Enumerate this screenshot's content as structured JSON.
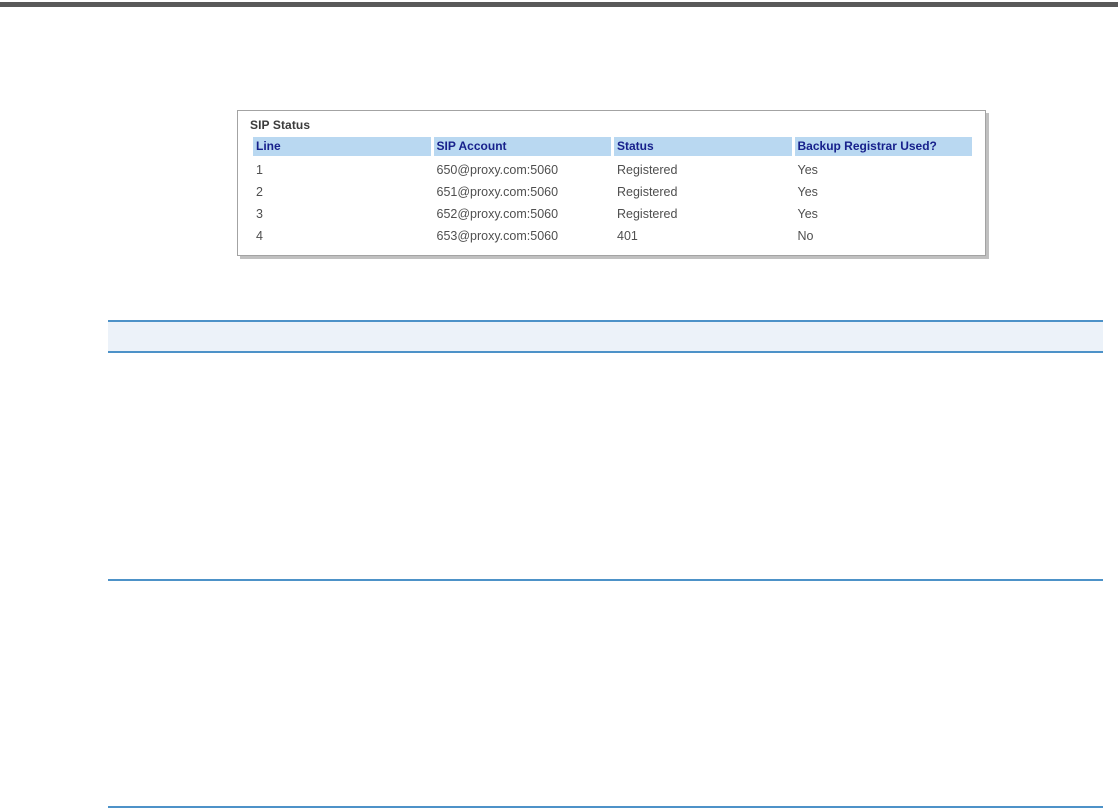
{
  "colors": {
    "top_bar": "#595959",
    "rule": "#4d92c8",
    "note_band_fill": "#ecf2f9",
    "table_header_bg": "#b9d8f1",
    "table_header_text": "#17218c",
    "table_body_text": "#4f4f4f"
  },
  "figure": {
    "title": "SIP Status",
    "table": {
      "columns": [
        "Line",
        "SIP Account",
        "Status",
        "Backup Registrar Used?"
      ],
      "rows": [
        [
          "1",
          "650@proxy.com:5060",
          "Registered",
          "Yes"
        ],
        [
          "2",
          "651@proxy.com:5060",
          "Registered",
          "Yes"
        ],
        [
          "3",
          "652@proxy.com:5060",
          "Registered",
          "Yes"
        ],
        [
          "4",
          "653@proxy.com:5060",
          "401",
          "No"
        ]
      ]
    }
  }
}
